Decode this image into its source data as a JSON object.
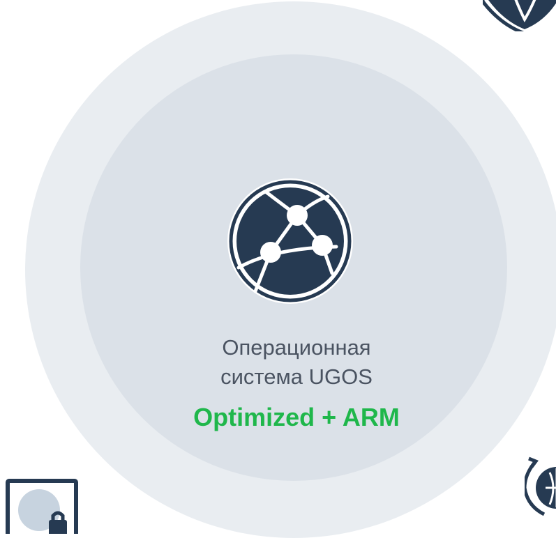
{
  "feature": {
    "title_line1": "Операционная",
    "title_line2": "система UGOS",
    "tag": "Optimized + ARM"
  },
  "colors": {
    "accent_green": "#1fb74b",
    "icon_dark": "#263a52",
    "outer_ring": "#e9edf1",
    "inner_ring": "#dbe1e8",
    "text": "#4a5361"
  },
  "icons": {
    "center": "network-nodes-icon",
    "top_right": "shield-icon",
    "bottom_left": "remote-desktop-icon",
    "bottom_right": "globe-sync-icon"
  }
}
